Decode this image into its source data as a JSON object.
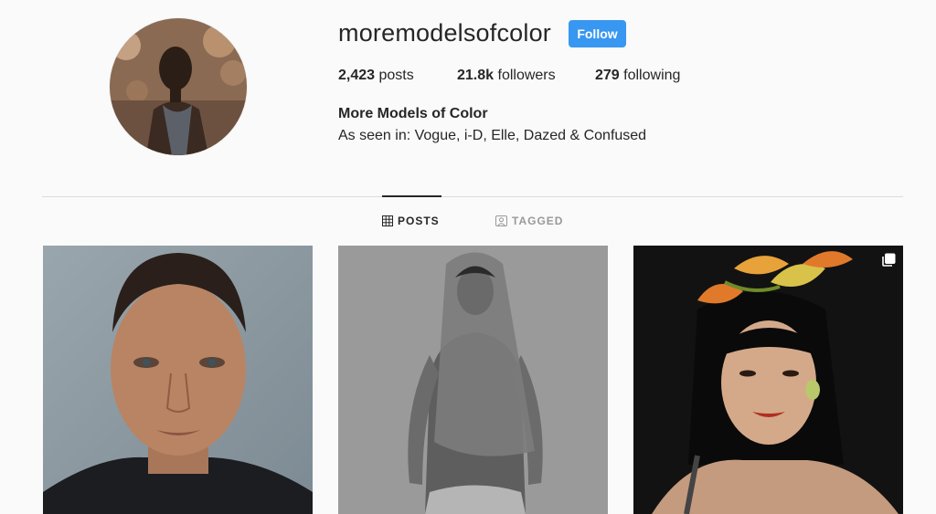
{
  "profile": {
    "username": "moremodelsofcolor",
    "follow_label": "Follow",
    "full_name": "More Models of Color",
    "bio": "As seen in: Vogue, i-D, Elle, Dazed & Confused"
  },
  "stats": {
    "posts_count": "2,423",
    "posts_label": "posts",
    "followers_count": "21.8k",
    "followers_label": "followers",
    "following_count": "279",
    "following_label": "following"
  },
  "tabs": {
    "posts": "POSTS",
    "tagged": "TAGGED"
  },
  "posts": [
    {
      "icon": "none"
    },
    {
      "icon": "none"
    },
    {
      "icon": "multiple-photos-icon"
    }
  ],
  "colors": {
    "follow_button": "#3897f0",
    "text": "#262626",
    "muted": "#999999",
    "divider": "#dbdbdb",
    "background": "#fafafa"
  }
}
